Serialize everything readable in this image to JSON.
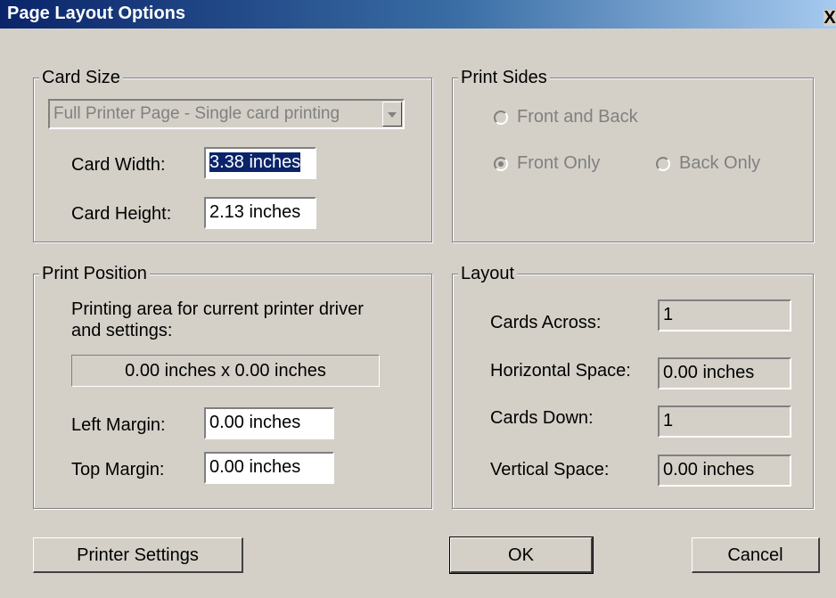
{
  "window": {
    "title": "Page Layout Options",
    "close_glyph": "X"
  },
  "card_size": {
    "legend": "Card Size",
    "dropdown_value": "Full Printer Page - Single card printing",
    "width_label": "Card Width:",
    "width_value": "3.38 inches",
    "height_label": "Card Height:",
    "height_value": "2.13 inches"
  },
  "print_sides": {
    "legend": "Print Sides",
    "front_and_back": "Front and Back",
    "front_only": "Front Only",
    "back_only": "Back Only",
    "selected": "front_only"
  },
  "print_position": {
    "legend": "Print Position",
    "desc_line1": "Printing area for current printer driver",
    "desc_line2": "and settings:",
    "area_value": "0.00 inches x 0.00 inches",
    "left_margin_label": "Left Margin:",
    "left_margin_value": "0.00 inches",
    "top_margin_label": "Top Margin:",
    "top_margin_value": "0.00 inches"
  },
  "layout": {
    "legend": "Layout",
    "cards_across_label": "Cards Across:",
    "cards_across_value": "1",
    "horizontal_space_label": "Horizontal Space:",
    "horizontal_space_value": "0.00 inches",
    "cards_down_label": "Cards Down:",
    "cards_down_value": "1",
    "vertical_space_label": "Vertical Space:",
    "vertical_space_value": "0.00 inches"
  },
  "buttons": {
    "printer_settings": "Printer Settings",
    "ok": "OK",
    "cancel": "Cancel"
  }
}
